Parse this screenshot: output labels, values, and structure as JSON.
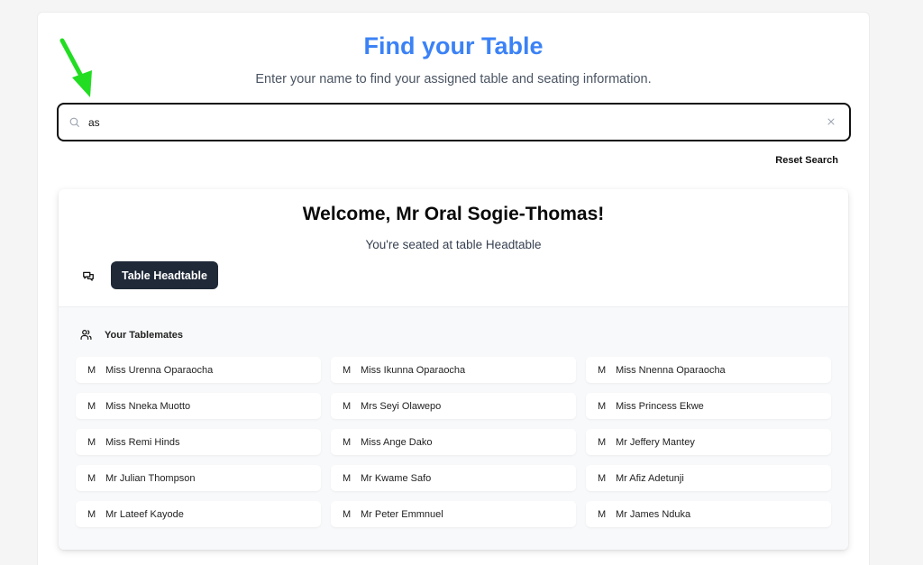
{
  "header": {
    "title": "Find your Table",
    "subtitle": "Enter your name to find your assigned table and seating information."
  },
  "search": {
    "value": "as",
    "placeholder": ""
  },
  "reset_label": "Reset Search",
  "result": {
    "welcome": "Welcome, Mr Oral Sogie-Thomas!",
    "seated_text": "You're seated at table Headtable",
    "table_button": "Table Headtable"
  },
  "tablemates": {
    "heading": "Your Tablemates",
    "items": [
      {
        "initial": "M",
        "name": "Miss Urenna Oparaocha"
      },
      {
        "initial": "M",
        "name": "Miss Ikunna Oparaocha"
      },
      {
        "initial": "M",
        "name": "Miss Nnenna Oparaocha"
      },
      {
        "initial": "M",
        "name": "Miss Nneka Muotto"
      },
      {
        "initial": "M",
        "name": "Mrs Seyi Olawepo"
      },
      {
        "initial": "M",
        "name": "Miss Princess Ekwe"
      },
      {
        "initial": "M",
        "name": "Miss Remi Hinds"
      },
      {
        "initial": "M",
        "name": "Miss Ange Dako"
      },
      {
        "initial": "M",
        "name": "Mr Jeffery Mantey"
      },
      {
        "initial": "M",
        "name": "Mr Julian Thompson"
      },
      {
        "initial": "M",
        "name": "Mr Kwame Safo"
      },
      {
        "initial": "M",
        "name": "Mr Afiz Adetunji"
      },
      {
        "initial": "M",
        "name": "Mr Lateef Kayode"
      },
      {
        "initial": "M",
        "name": "Mr Peter Emmnuel"
      },
      {
        "initial": "M",
        "name": "Mr James Nduka"
      }
    ]
  },
  "colors": {
    "accent": "#3b82f6",
    "button_dark": "#1f2937",
    "annotation_arrow": "#22dd22"
  }
}
